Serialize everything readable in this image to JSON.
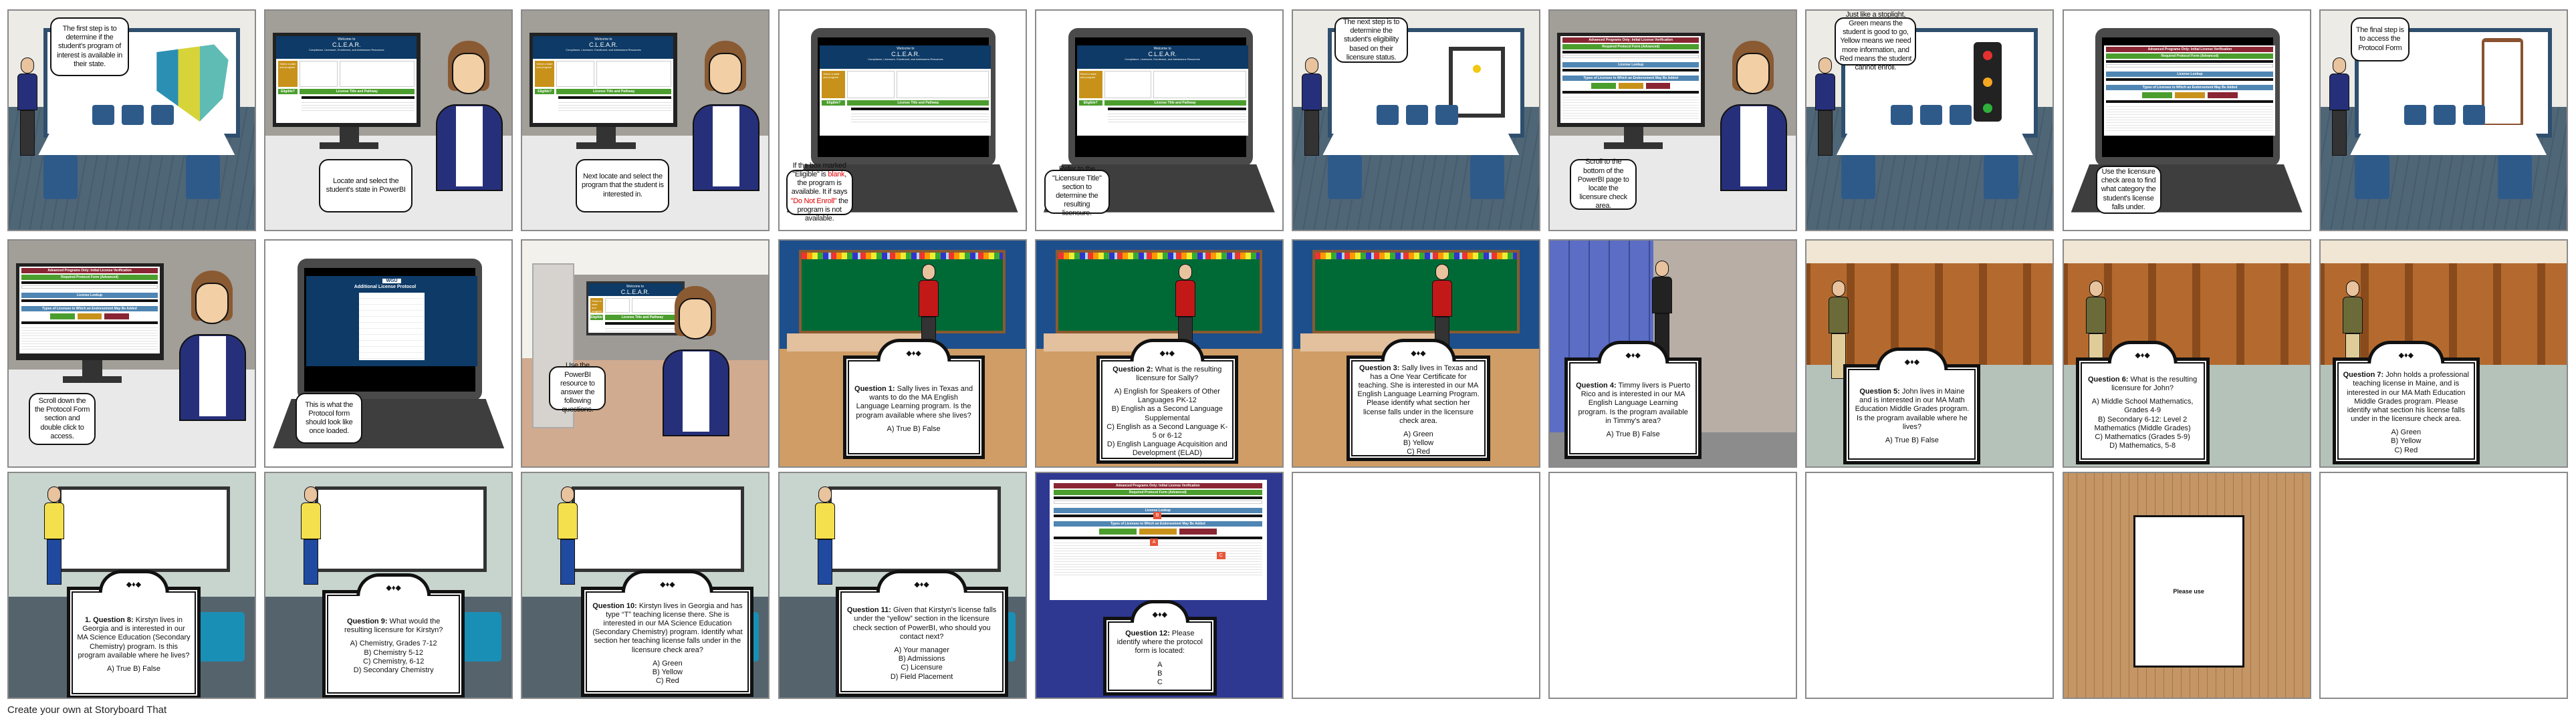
{
  "footer": "Create your own at Storyboard That",
  "screens": {
    "clear": {
      "welcome": "Welcome to",
      "title": "C.L.E.A.R.",
      "subtitle": "Compliance, Licensure, Enrollment, and Admissions Resources",
      "select_label": "Select a state and program",
      "eligible": "Eligible?",
      "pathway": "License Title and Pathway"
    },
    "advanced": {
      "title": "Advanced Programs Only: Initial License Verification",
      "protocol": "Required Protocol Form (Advanced)",
      "lookup": "License Lookup",
      "types": "Types of Licenses to Which an Endorsement May Be Added",
      "marker_a": "A",
      "marker_b": "B",
      "marker_c": "C"
    },
    "protocol_form": {
      "logo": "WGU",
      "title": "Additional License Protocol"
    }
  },
  "colors": {
    "navy": "#0d3a66",
    "green": "#4b9e2d",
    "gold": "#c8921a",
    "maroon": "#8a2633",
    "steel": "#4f86b3",
    "highlight_red": "#e00000"
  },
  "panels": [
    {
      "scene": "whiteboard",
      "board": "us-map",
      "caption": [
        "The first step is to determine if the student's program of interest is available in their state."
      ]
    },
    {
      "scene": "desk",
      "screen": "clear",
      "caption": [
        "Locate and select the student's state in PowerBI"
      ]
    },
    {
      "scene": "desk",
      "screen": "clear",
      "caption": [
        "Next locate and select the program that the student is interested in."
      ]
    },
    {
      "scene": "laptop",
      "screen": "clear",
      "caption": [
        "If the box marked \"Eligible\" is ",
        "blank",
        ", the program is available. It if says ",
        "\"Do Not Enroll\"",
        " the program is not available."
      ]
    },
    {
      "scene": "laptop",
      "screen": "clear",
      "caption": [
        "Refer to the \"Licensure Title\" section to determine the resulting licensure."
      ]
    },
    {
      "scene": "whiteboard",
      "board": "certificate",
      "caption": [
        "The next step is to determine the student's eligibility based on their licensure status."
      ]
    },
    {
      "scene": "desk",
      "screen": "advanced",
      "caption": [
        "Scroll to the bottom of the PowerBI page to locate the licensure check area."
      ]
    },
    {
      "scene": "whiteboard",
      "board": "stoplight",
      "caption": [
        "Just like a stoplight, Green means the student is good to go, Yellow means we need more information, and Red means the student cannot enroll."
      ]
    },
    {
      "scene": "laptop",
      "screen": "advanced",
      "caption": [
        "Use the licensure check area to find what category the student's license falls under."
      ]
    },
    {
      "scene": "whiteboard",
      "board": "clipboard",
      "caption": [
        "The final step is to access the Protocol Form"
      ]
    },
    {
      "scene": "desk",
      "screen": "advanced",
      "caption": [
        "Scroll down the the Protocol Form section and double click to access."
      ]
    },
    {
      "scene": "laptop",
      "screen": "protocol",
      "caption": [
        "This is what the Protocol form should look like once loaded."
      ]
    },
    {
      "scene": "cubicle",
      "screen": "clear",
      "caption": [
        "Use the PowerBI resource to answer the following questions."
      ]
    },
    {
      "scene": "teacher",
      "question": {
        "label": "Question 1:",
        "text": " Sally lives in Texas and wants to do the MA English Language Learning program. Is the program available where she lives?",
        "options": "A) True B) False"
      }
    },
    {
      "scene": "teacher",
      "question": {
        "label": "Question 2:",
        "text": " What is the resulting licensure for Sally?",
        "options": "A) English for Speakers of Other Languages PK-12\nB) English as a Second Language Supplemental\nC) English as a Second Language K-5 or 6-12\nD) English Language Acquisition and Development (ELAD)"
      }
    },
    {
      "scene": "teacher",
      "question": {
        "label": "Question 3:",
        "text": " Sally lives in Texas and has a One Year Certificate for teaching. She is interested in our MA English Language Learning Program. Please identify what section her license falls under in the licensure check area.",
        "options": "A) Green\nB) Yellow\nC) Red"
      }
    },
    {
      "scene": "hallway",
      "question": {
        "label": "Question 4:",
        "text": " Timmy livers is Puerto Rico and is interested in our MA English Language Learning program. Is the program available in Timmy's area?",
        "options": "A) True B) False"
      }
    },
    {
      "scene": "library",
      "question": {
        "label": "Question 5:",
        "text": " John lives in Maine and is interested in our MA Math Education Middle Grades program. Is the program available where he lives?",
        "options": "A) True B) False"
      }
    },
    {
      "scene": "library",
      "question": {
        "label": "Question 6:",
        "text": " What is the resulting licensure for John?",
        "options": "A) Middle School Mathematics, Grades 4-9\nB) Secondary 6-12: Level 2 Mathematics (Middle Grades)\nC) Mathematics (Grades 5-9)\nD) Mathematics, 5-8"
      }
    },
    {
      "scene": "library",
      "question": {
        "label": "Question 7:",
        "text": " John holds a professional teaching license in Maine, and is interested in our MA Math Education Middle Grades program. Please identify what section his license falls under in the licensure check area.",
        "options": "A) Green\nB) Yellow\nC) Red"
      }
    },
    {
      "scene": "school",
      "question": {
        "label": "1. Question 8:",
        "text": " Kirstyn lives in Georgia and is interested in our MA Science Education (Secondary Chemistry) program. Is this program available where he lives?",
        "options": "A) True B) False"
      }
    },
    {
      "scene": "school",
      "question": {
        "label": "Question 9:",
        "text": " What would the resulting licensure for Kirstyn?",
        "options": "A) Chemistry, Grades 7-12\nB) Chemistry 5-12\nC) Chemistry, 6-12\nD) Secondary Chemistry"
      }
    },
    {
      "scene": "school",
      "question": {
        "label": "Question 10:",
        "text": " Kirstyn lives in Georgia and has type “T” teaching license there. She is interested in our MA Science Education (Secondary Chemistry) program. Identify what section her teaching license falls under in the licensure check area?",
        "options": "A) Green\nB) Yellow\nC) Red"
      }
    },
    {
      "scene": "school",
      "question": {
        "label": "Question 11:",
        "text": " Given that Kirstyn's license falls under the “yellow” section in the licensure check section of PowerBI, who should you contact next?",
        "options": "A) Your manager\nB) Admissions\nC) Licensure\nD) Field Placement"
      }
    },
    {
      "scene": "powerbi",
      "question": {
        "label": "Question 12:",
        "text": " Please identify where the protocol form is located:",
        "options": "A\nB\nC"
      }
    },
    {
      "scene": "blank"
    },
    {
      "scene": "blank"
    },
    {
      "scene": "blank"
    },
    {
      "scene": "wood",
      "note": "Please use"
    },
    {
      "scene": "blank"
    }
  ]
}
